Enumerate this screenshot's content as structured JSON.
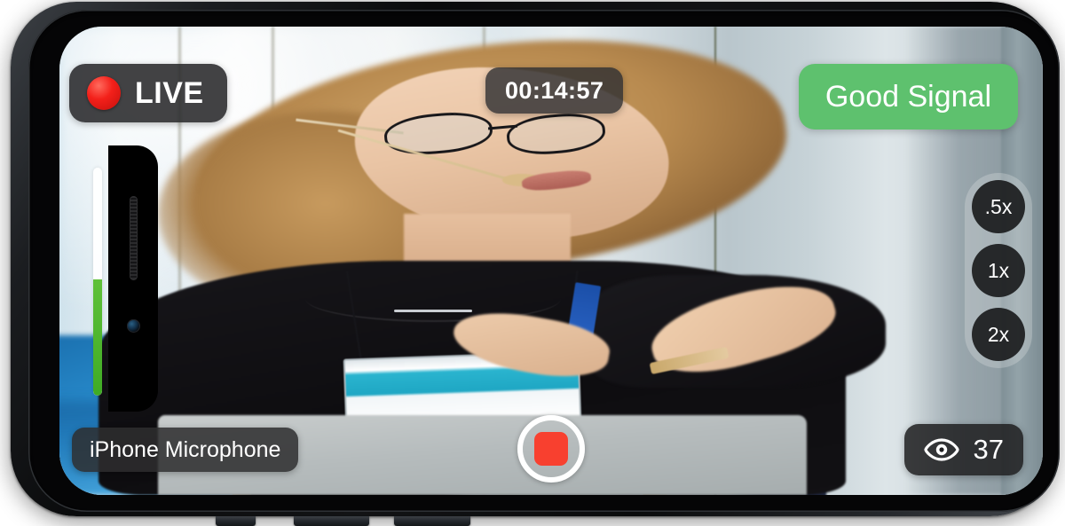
{
  "device": {
    "name": "iphone-landscape",
    "orientation": "landscape"
  },
  "stream": {
    "live_label": "LIVE",
    "timer": "00:14:57",
    "signal_status": "Good Signal",
    "signal_color": "#5ec16e",
    "microphone_source": "iPhone Microphone",
    "viewer_count": "37",
    "record_state": "recording"
  },
  "zoom_controls": {
    "options": [
      {
        "label": ".5x",
        "value": 0.5,
        "selected": false
      },
      {
        "label": "1x",
        "value": 1,
        "selected": true
      },
      {
        "label": "2x",
        "value": 2,
        "selected": false
      }
    ]
  },
  "audio_meter": {
    "level_percent": 51
  },
  "icons": {
    "live_dot": "record-dot-icon",
    "eye": "eye-icon",
    "stop": "stop-square-icon"
  },
  "colors": {
    "accent_red": "#f8402f",
    "live_red": "#f3201a",
    "signal_green": "#5ec16e",
    "meter_green": "#4fb52d",
    "badge_dark": "#202022"
  }
}
